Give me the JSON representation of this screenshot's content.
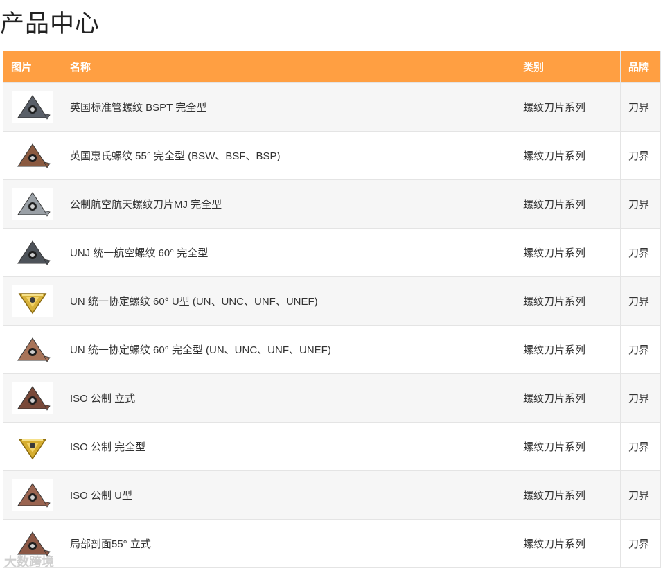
{
  "page": {
    "title": "产品中心"
  },
  "table": {
    "headers": {
      "image": "图片",
      "name": "名称",
      "category": "类别",
      "brand": "品牌"
    },
    "rows": [
      {
        "name": "英国标准管螺纹 BSPT 完全型",
        "category": "螺纹刀片系列",
        "brand": "刀界",
        "icon": "gray-triangle-insert-icon",
        "color": "#5a5f68"
      },
      {
        "name": "英国惠氏螺纹 55° 完全型 (BSW、BSF、BSP)",
        "category": "螺纹刀片系列",
        "brand": "刀界",
        "icon": "bronze-triangle-insert-icon",
        "color": "#8a5a40"
      },
      {
        "name": "公制航空航天螺纹刀片MJ 完全型",
        "category": "螺纹刀片系列",
        "brand": "刀界",
        "icon": "silver-triangle-insert-icon",
        "color": "#9aa0a6"
      },
      {
        "name": "UNJ 统一航空螺纹 60° 完全型",
        "category": "螺纹刀片系列",
        "brand": "刀界",
        "icon": "gray-triangle-insert-icon",
        "color": "#4e535a"
      },
      {
        "name": "UN 统一协定螺纹 60° U型 (UN、UNC、UNF、UNEF)",
        "category": "螺纹刀片系列",
        "brand": "刀界",
        "icon": "gold-triangle-insert-icon",
        "color": "#d8b23a"
      },
      {
        "name": "UN 统一协定螺纹 60° 完全型 (UN、UNC、UNF、UNEF)",
        "category": "螺纹刀片系列",
        "brand": "刀界",
        "icon": "bronze-triangle-insert-icon",
        "color": "#a8745a"
      },
      {
        "name": "ISO 公制 立式",
        "category": "螺纹刀片系列",
        "brand": "刀界",
        "icon": "copper-triangle-insert-icon",
        "color": "#7a4a3a"
      },
      {
        "name": "ISO 公制 完全型",
        "category": "螺纹刀片系列",
        "brand": "刀界",
        "icon": "gold-triangle-insert-icon",
        "color": "#d6ad2e"
      },
      {
        "name": "ISO 公制 U型",
        "category": "螺纹刀片系列",
        "brand": "刀界",
        "icon": "copper-triangle-insert-icon",
        "color": "#9a6450"
      },
      {
        "name": "局部剖面55° 立式",
        "category": "螺纹刀片系列",
        "brand": "刀界",
        "icon": "copper-triangle-insert-icon",
        "color": "#8c5846"
      }
    ]
  },
  "watermark": "大数跨境"
}
